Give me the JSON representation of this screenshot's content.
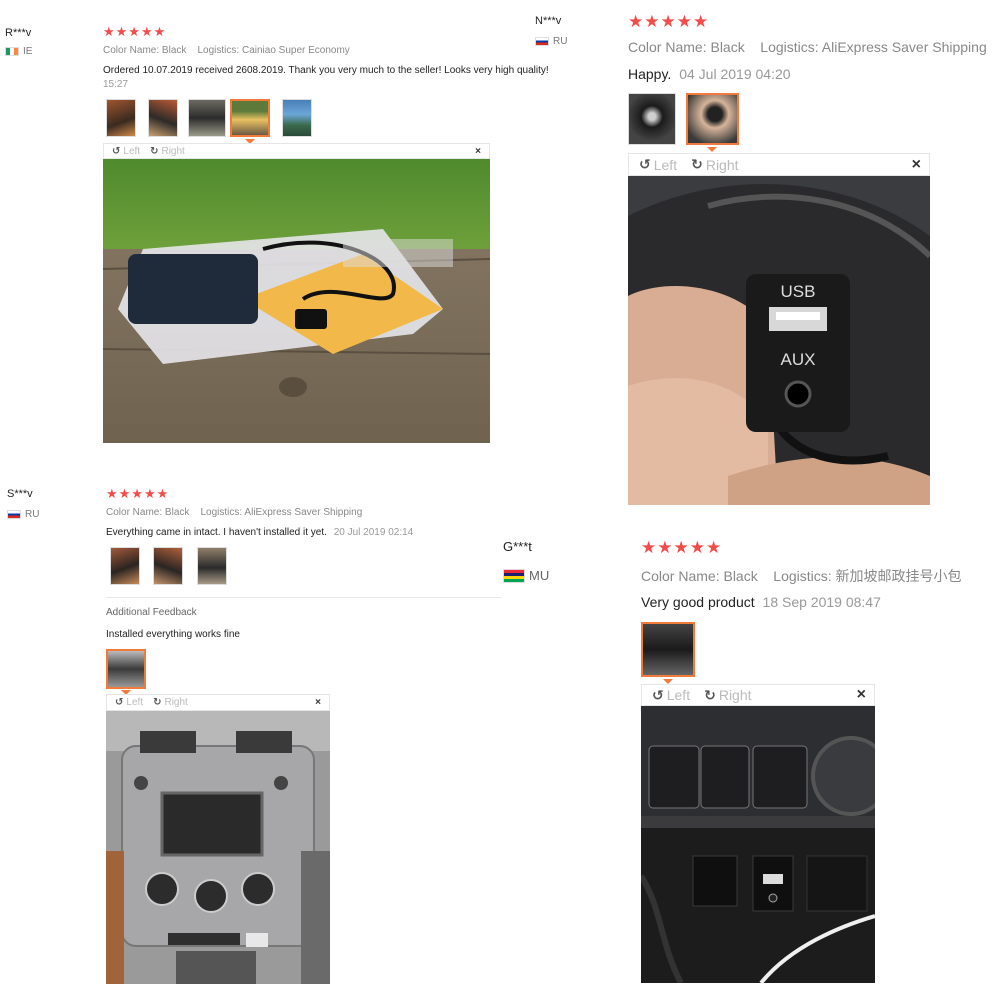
{
  "reviews": [
    {
      "user": "R***v",
      "country": "IE",
      "stars": "★★★★★",
      "color_label": "Color Name:",
      "color_value": "Black",
      "logistics_label": "Logistics:",
      "logistics_value": "Cainiao Super Economy",
      "text": "Ordered 10.07.2019 received 2608.2019. Thank you very much to the seller! Looks very high quality!",
      "date": "15:27",
      "viewer": {
        "left": "Left",
        "right": "Right",
        "close": "×"
      }
    },
    {
      "user": "N***v",
      "country": "RU",
      "stars": "★★★★★",
      "color_label": "Color Name:",
      "color_value": "Black",
      "logistics_label": "Logistics:",
      "logistics_value": "AliExpress Saver Shipping",
      "text": "Happy.",
      "date": "04 Jul 2019 04:20",
      "viewer": {
        "left": "Left",
        "right": "Right",
        "close": "×"
      },
      "photo_label_usb": "USB",
      "photo_label_aux": "AUX"
    },
    {
      "user": "S***v",
      "country": "RU",
      "stars": "★★★★★",
      "color_label": "Color Name:",
      "color_value": "Black",
      "logistics_label": "Logistics:",
      "logistics_value": "AliExpress Saver Shipping",
      "text": "Everything came in intact. I haven't installed it yet.",
      "date": "20 Jul 2019 02:14",
      "additional_title": "Additional Feedback",
      "additional_text": "Installed everything works fine",
      "viewer": {
        "left": "Left",
        "right": "Right",
        "close": "×"
      }
    },
    {
      "user": "G***t",
      "country": "MU",
      "stars": "★★★★★",
      "color_label": "Color Name:",
      "color_value": "Black",
      "logistics_label": "Logistics:",
      "logistics_value": "新加坡邮政挂号小包",
      "text": "Very good product",
      "date": "18 Sep 2019 08:47",
      "viewer": {
        "left": "Left",
        "right": "Right",
        "close": "×"
      }
    }
  ],
  "colors": {
    "star": "#f44b4b",
    "selected_border": "#f27a3a"
  }
}
